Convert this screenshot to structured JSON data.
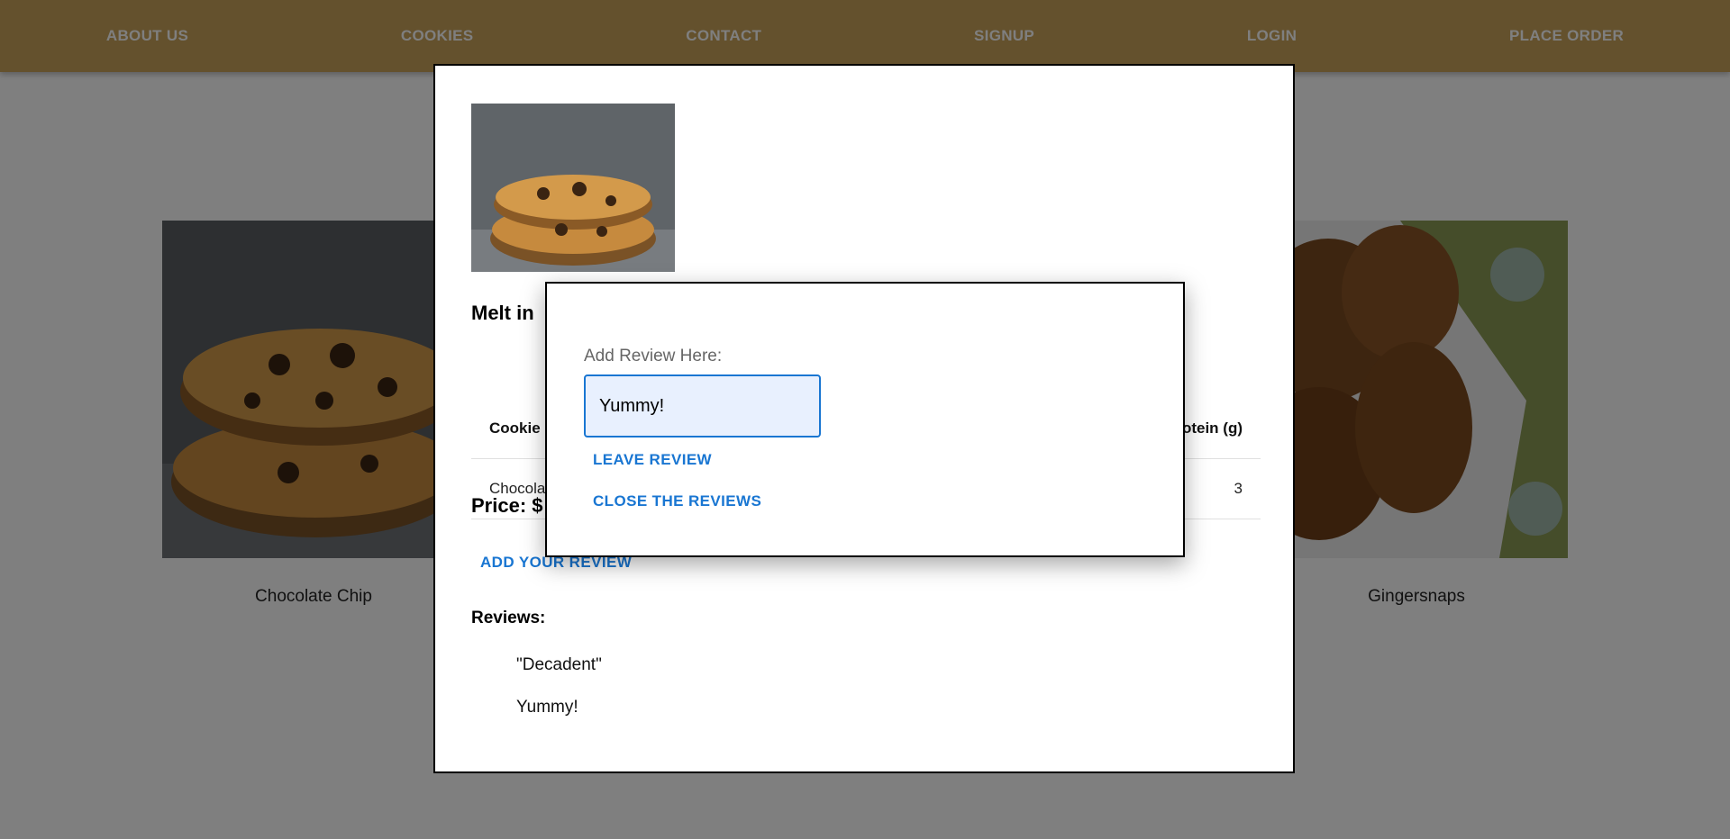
{
  "nav": {
    "items": [
      {
        "label": "ABOUT US"
      },
      {
        "label": "COOKIES"
      },
      {
        "label": "CONTACT"
      },
      {
        "label": "SIGNUP"
      },
      {
        "label": "LOGIN"
      },
      {
        "label": "PLACE ORDER"
      }
    ]
  },
  "cards": {
    "left": {
      "label": "Chocolate Chip"
    },
    "right": {
      "label": "Gingersnaps"
    }
  },
  "modal": {
    "description": "Melt in",
    "table": {
      "headers": [
        "Cookie",
        "Protein (g)"
      ],
      "visible_header_first": "Cookie",
      "visible_header_last": "otein (g)",
      "row": {
        "first": "Chocola",
        "last": "3"
      }
    },
    "price_label": "Price: $",
    "add_review_label": "ADD YOUR REVIEW",
    "reviews_heading": "Reviews:",
    "reviews": [
      "\"Decadent\"",
      "Yummy!"
    ]
  },
  "review_popup": {
    "label": "Add Review Here:",
    "input_value": "Yummy!",
    "leave_review_label": "LEAVE REVIEW",
    "close_reviews_label": "CLOSE THE REVIEWS"
  },
  "colors": {
    "navbar": "#c8a35a",
    "accent": "#1976d2",
    "input_bg": "#e8f0fe"
  }
}
